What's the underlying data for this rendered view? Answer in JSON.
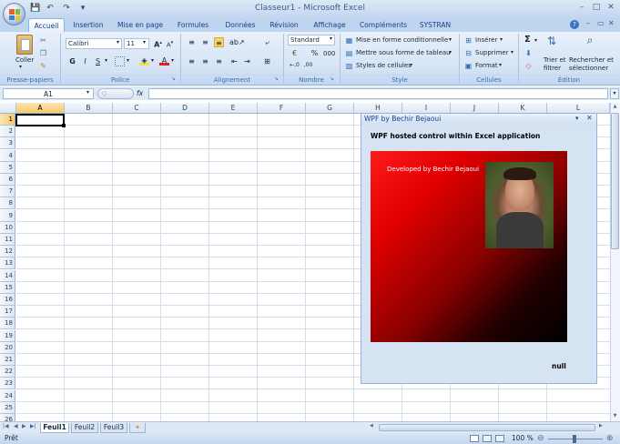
{
  "window": {
    "title": "Classeur1 - Microsoft Excel"
  },
  "qat": {
    "save": "💾",
    "undo": "↶",
    "redo": "↷",
    "customize": "▾"
  },
  "tabs": [
    "Accueil",
    "Insertion",
    "Mise en page",
    "Formules",
    "Données",
    "Révision",
    "Affichage",
    "Compléments",
    "SYSTRAN"
  ],
  "ribbon": {
    "clipboard": {
      "paste": "Coller",
      "label": "Presse-papiers"
    },
    "font": {
      "name": "Calibri",
      "size": "11",
      "bold": "G",
      "italic": "I",
      "underline": "S",
      "label": "Police"
    },
    "alignment": {
      "label": "Alignement"
    },
    "number": {
      "format": "Standard",
      "percent": "%",
      "thousands": "000",
      "label": "Nombre"
    },
    "style": {
      "conditional": "Mise en forme conditionnelle",
      "table": "Mettre sous forme de tableau",
      "cellstyles": "Styles de cellules",
      "label": "Style"
    },
    "cells": {
      "insert": "Insérer",
      "delete": "Supprimer",
      "format": "Format",
      "label": "Cellules"
    },
    "editing": {
      "sum": "Σ",
      "sort1": "Trier et",
      "sort2": "filtrer",
      "find1": "Rechercher et",
      "find2": "sélectionner",
      "label": "Édition"
    }
  },
  "formula_bar": {
    "cell_ref": "A1",
    "fx": "fx",
    "value": ""
  },
  "columns": [
    "A",
    "B",
    "C",
    "D",
    "E",
    "F",
    "G",
    "H",
    "I",
    "J",
    "K",
    "L"
  ],
  "rows": [
    "1",
    "2",
    "3",
    "4",
    "5",
    "6",
    "7",
    "8",
    "9",
    "10",
    "11",
    "12",
    "13",
    "14",
    "15",
    "16",
    "17",
    "18",
    "19",
    "20",
    "21",
    "22",
    "23",
    "24",
    "25",
    "26"
  ],
  "sheets": [
    "Feuil1",
    "Feuil2",
    "Feuil3"
  ],
  "status": {
    "ready": "Prêt",
    "zoom": "100 %"
  },
  "pane": {
    "title": "WPF by Bechir Bejaoui",
    "heading": "WPF hosted control within Excel application",
    "developer": "Developed by Bechir Bejaoui",
    "footer": "null"
  },
  "colors": {
    "accent": "#15428b",
    "gradient_start": "#ff1a1a",
    "gradient_end": "#000000"
  }
}
